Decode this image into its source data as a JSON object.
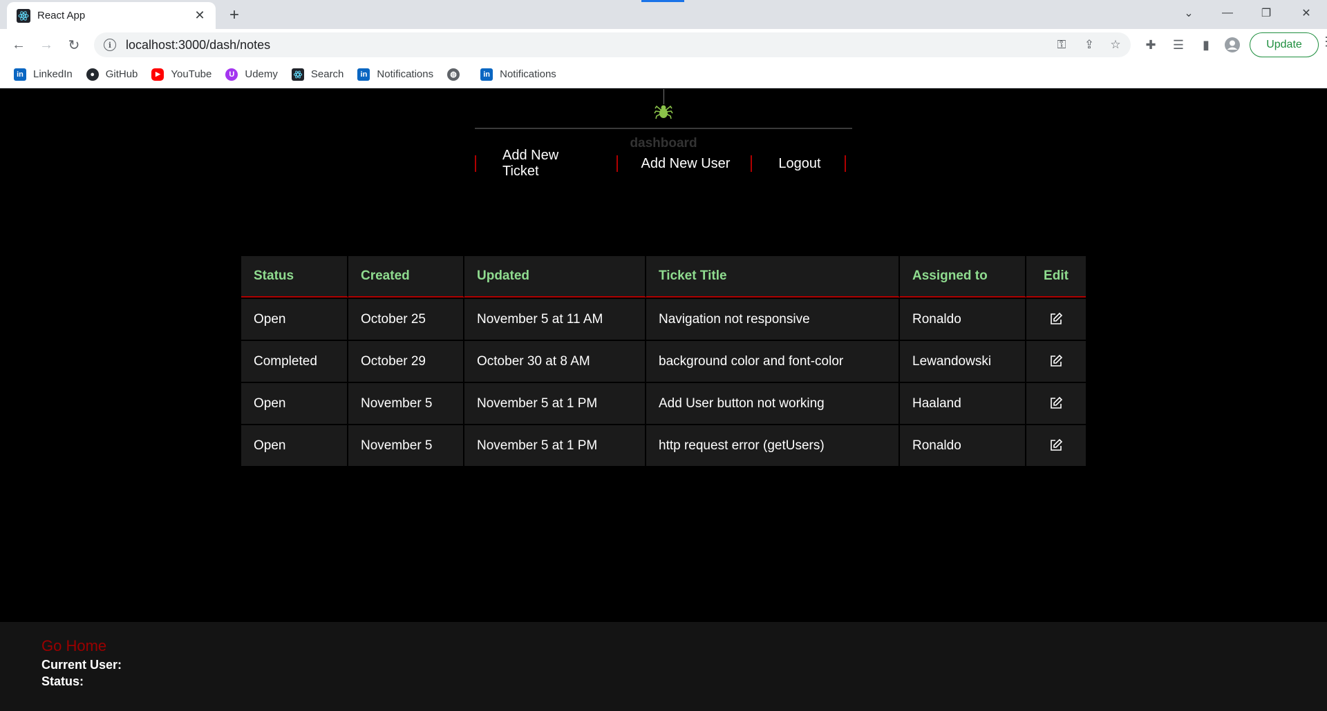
{
  "browser": {
    "tab_title": "React App",
    "url": "localhost:3000/dash/notes",
    "update_label": "Update",
    "bookmarks": [
      {
        "label": "LinkedIn",
        "icon": "linkedin-icon"
      },
      {
        "label": "GitHub",
        "icon": "github-icon"
      },
      {
        "label": "YouTube",
        "icon": "youtube-icon"
      },
      {
        "label": "Udemy",
        "icon": "udemy-icon"
      },
      {
        "label": "Search",
        "icon": "react-icon"
      },
      {
        "label": "Notifications",
        "icon": "linkedin-icon"
      },
      {
        "label": "",
        "icon": "globe-icon"
      },
      {
        "label": "Notifications",
        "icon": "linkedin-icon"
      }
    ]
  },
  "header": {
    "title": "dashboard",
    "logo_icon": "spider-icon",
    "nav": {
      "add_ticket": "Add New Ticket",
      "add_user": "Add New User",
      "logout": "Logout"
    }
  },
  "table": {
    "columns": [
      "Status",
      "Created",
      "Updated",
      "Ticket Title",
      "Assigned to",
      "Edit"
    ],
    "rows": [
      {
        "status": "Open",
        "created": "October 25",
        "updated": "November 5 at 11 AM",
        "title": "Navigation not responsive",
        "assigned": "Ronaldo"
      },
      {
        "status": "Completed",
        "created": "October 29",
        "updated": "October 30 at 8 AM",
        "title": "background color and font-color",
        "assigned": "Lewandowski"
      },
      {
        "status": "Open",
        "created": "November 5",
        "updated": "November 5 at 1 PM",
        "title": "Add User button not working",
        "assigned": "Haaland"
      },
      {
        "status": "Open",
        "created": "November 5",
        "updated": "November 5 at 1 PM",
        "title": "http request error (getUsers)",
        "assigned": "Ronaldo"
      }
    ]
  },
  "footer": {
    "go_home": "Go Home",
    "current_user_label": "Current User:",
    "status_label": "Status:"
  },
  "colors": {
    "accent_red": "#b00000",
    "header_green": "#8fdc8f",
    "logo_green": "#8bc34a"
  }
}
